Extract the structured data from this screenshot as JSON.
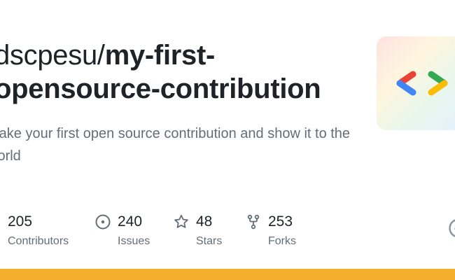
{
  "repo": {
    "owner": "dscpesu/",
    "name_line1": "my-first-",
    "name_line2": "opensource-contribution",
    "description": "Make your first open source contribution and show it to the world"
  },
  "stats": {
    "contributors": {
      "value": "205",
      "label": "Contributors"
    },
    "issues": {
      "value": "240",
      "label": "Issues"
    },
    "stars": {
      "value": "48",
      "label": "Stars"
    },
    "forks": {
      "value": "253",
      "label": "Forks"
    }
  },
  "icons": {
    "logo": "gdsc-brackets-logo",
    "issues": "issue-circle-icon",
    "stars": "star-icon",
    "forks": "repo-forked-icon",
    "edge": "github-logo-icon"
  },
  "colors": {
    "title": "#1f2328",
    "muted": "#656d76",
    "bottom_bar": "#f6ae2d",
    "logo_red": "#ea4335",
    "logo_blue": "#4285f4",
    "logo_green": "#34a853",
    "logo_yellow": "#fbbc04"
  }
}
